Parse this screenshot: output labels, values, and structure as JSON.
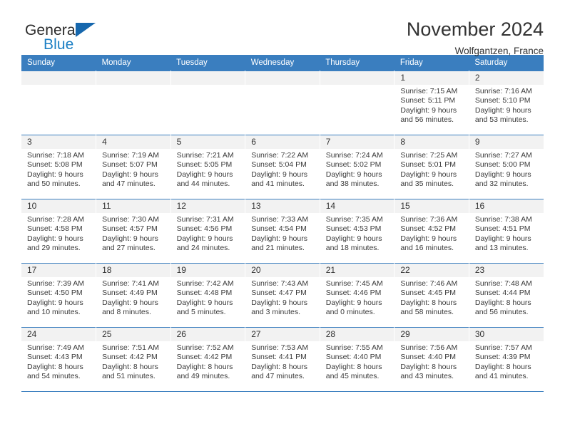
{
  "brand": {
    "name_part1": "General",
    "name_part2": "Blue",
    "logo_icon": "triangle-logo-icon"
  },
  "header": {
    "month_title": "November 2024",
    "location": "Wolfgantzen, France"
  },
  "calendar": {
    "weekdays": [
      "Sunday",
      "Monday",
      "Tuesday",
      "Wednesday",
      "Thursday",
      "Friday",
      "Saturday"
    ],
    "colors": {
      "header_background": "#3a7ebf",
      "header_text": "#ffffff",
      "daynum_background": "#f2f2f2",
      "grid_line": "#3a7ebf",
      "brand_blue": "#1b7fc4",
      "logo_blue": "#1667ad"
    },
    "weeks": [
      [
        {
          "day": "",
          "empty": true
        },
        {
          "day": "",
          "empty": true
        },
        {
          "day": "",
          "empty": true
        },
        {
          "day": "",
          "empty": true
        },
        {
          "day": "",
          "empty": true
        },
        {
          "day": "1",
          "sunrise": "Sunrise: 7:15 AM",
          "sunset": "Sunset: 5:11 PM",
          "daylight_line1": "Daylight: 9 hours",
          "daylight_line2": "and 56 minutes."
        },
        {
          "day": "2",
          "sunrise": "Sunrise: 7:16 AM",
          "sunset": "Sunset: 5:10 PM",
          "daylight_line1": "Daylight: 9 hours",
          "daylight_line2": "and 53 minutes."
        }
      ],
      [
        {
          "day": "3",
          "sunrise": "Sunrise: 7:18 AM",
          "sunset": "Sunset: 5:08 PM",
          "daylight_line1": "Daylight: 9 hours",
          "daylight_line2": "and 50 minutes."
        },
        {
          "day": "4",
          "sunrise": "Sunrise: 7:19 AM",
          "sunset": "Sunset: 5:07 PM",
          "daylight_line1": "Daylight: 9 hours",
          "daylight_line2": "and 47 minutes."
        },
        {
          "day": "5",
          "sunrise": "Sunrise: 7:21 AM",
          "sunset": "Sunset: 5:05 PM",
          "daylight_line1": "Daylight: 9 hours",
          "daylight_line2": "and 44 minutes."
        },
        {
          "day": "6",
          "sunrise": "Sunrise: 7:22 AM",
          "sunset": "Sunset: 5:04 PM",
          "daylight_line1": "Daylight: 9 hours",
          "daylight_line2": "and 41 minutes."
        },
        {
          "day": "7",
          "sunrise": "Sunrise: 7:24 AM",
          "sunset": "Sunset: 5:02 PM",
          "daylight_line1": "Daylight: 9 hours",
          "daylight_line2": "and 38 minutes."
        },
        {
          "day": "8",
          "sunrise": "Sunrise: 7:25 AM",
          "sunset": "Sunset: 5:01 PM",
          "daylight_line1": "Daylight: 9 hours",
          "daylight_line2": "and 35 minutes."
        },
        {
          "day": "9",
          "sunrise": "Sunrise: 7:27 AM",
          "sunset": "Sunset: 5:00 PM",
          "daylight_line1": "Daylight: 9 hours",
          "daylight_line2": "and 32 minutes."
        }
      ],
      [
        {
          "day": "10",
          "sunrise": "Sunrise: 7:28 AM",
          "sunset": "Sunset: 4:58 PM",
          "daylight_line1": "Daylight: 9 hours",
          "daylight_line2": "and 29 minutes."
        },
        {
          "day": "11",
          "sunrise": "Sunrise: 7:30 AM",
          "sunset": "Sunset: 4:57 PM",
          "daylight_line1": "Daylight: 9 hours",
          "daylight_line2": "and 27 minutes."
        },
        {
          "day": "12",
          "sunrise": "Sunrise: 7:31 AM",
          "sunset": "Sunset: 4:56 PM",
          "daylight_line1": "Daylight: 9 hours",
          "daylight_line2": "and 24 minutes."
        },
        {
          "day": "13",
          "sunrise": "Sunrise: 7:33 AM",
          "sunset": "Sunset: 4:54 PM",
          "daylight_line1": "Daylight: 9 hours",
          "daylight_line2": "and 21 minutes."
        },
        {
          "day": "14",
          "sunrise": "Sunrise: 7:35 AM",
          "sunset": "Sunset: 4:53 PM",
          "daylight_line1": "Daylight: 9 hours",
          "daylight_line2": "and 18 minutes."
        },
        {
          "day": "15",
          "sunrise": "Sunrise: 7:36 AM",
          "sunset": "Sunset: 4:52 PM",
          "daylight_line1": "Daylight: 9 hours",
          "daylight_line2": "and 16 minutes."
        },
        {
          "day": "16",
          "sunrise": "Sunrise: 7:38 AM",
          "sunset": "Sunset: 4:51 PM",
          "daylight_line1": "Daylight: 9 hours",
          "daylight_line2": "and 13 minutes."
        }
      ],
      [
        {
          "day": "17",
          "sunrise": "Sunrise: 7:39 AM",
          "sunset": "Sunset: 4:50 PM",
          "daylight_line1": "Daylight: 9 hours",
          "daylight_line2": "and 10 minutes."
        },
        {
          "day": "18",
          "sunrise": "Sunrise: 7:41 AM",
          "sunset": "Sunset: 4:49 PM",
          "daylight_line1": "Daylight: 9 hours",
          "daylight_line2": "and 8 minutes."
        },
        {
          "day": "19",
          "sunrise": "Sunrise: 7:42 AM",
          "sunset": "Sunset: 4:48 PM",
          "daylight_line1": "Daylight: 9 hours",
          "daylight_line2": "and 5 minutes."
        },
        {
          "day": "20",
          "sunrise": "Sunrise: 7:43 AM",
          "sunset": "Sunset: 4:47 PM",
          "daylight_line1": "Daylight: 9 hours",
          "daylight_line2": "and 3 minutes."
        },
        {
          "day": "21",
          "sunrise": "Sunrise: 7:45 AM",
          "sunset": "Sunset: 4:46 PM",
          "daylight_line1": "Daylight: 9 hours",
          "daylight_line2": "and 0 minutes."
        },
        {
          "day": "22",
          "sunrise": "Sunrise: 7:46 AM",
          "sunset": "Sunset: 4:45 PM",
          "daylight_line1": "Daylight: 8 hours",
          "daylight_line2": "and 58 minutes."
        },
        {
          "day": "23",
          "sunrise": "Sunrise: 7:48 AM",
          "sunset": "Sunset: 4:44 PM",
          "daylight_line1": "Daylight: 8 hours",
          "daylight_line2": "and 56 minutes."
        }
      ],
      [
        {
          "day": "24",
          "sunrise": "Sunrise: 7:49 AM",
          "sunset": "Sunset: 4:43 PM",
          "daylight_line1": "Daylight: 8 hours",
          "daylight_line2": "and 54 minutes."
        },
        {
          "day": "25",
          "sunrise": "Sunrise: 7:51 AM",
          "sunset": "Sunset: 4:42 PM",
          "daylight_line1": "Daylight: 8 hours",
          "daylight_line2": "and 51 minutes."
        },
        {
          "day": "26",
          "sunrise": "Sunrise: 7:52 AM",
          "sunset": "Sunset: 4:42 PM",
          "daylight_line1": "Daylight: 8 hours",
          "daylight_line2": "and 49 minutes."
        },
        {
          "day": "27",
          "sunrise": "Sunrise: 7:53 AM",
          "sunset": "Sunset: 4:41 PM",
          "daylight_line1": "Daylight: 8 hours",
          "daylight_line2": "and 47 minutes."
        },
        {
          "day": "28",
          "sunrise": "Sunrise: 7:55 AM",
          "sunset": "Sunset: 4:40 PM",
          "daylight_line1": "Daylight: 8 hours",
          "daylight_line2": "and 45 minutes."
        },
        {
          "day": "29",
          "sunrise": "Sunrise: 7:56 AM",
          "sunset": "Sunset: 4:40 PM",
          "daylight_line1": "Daylight: 8 hours",
          "daylight_line2": "and 43 minutes."
        },
        {
          "day": "30",
          "sunrise": "Sunrise: 7:57 AM",
          "sunset": "Sunset: 4:39 PM",
          "daylight_line1": "Daylight: 8 hours",
          "daylight_line2": "and 41 minutes."
        }
      ]
    ]
  }
}
